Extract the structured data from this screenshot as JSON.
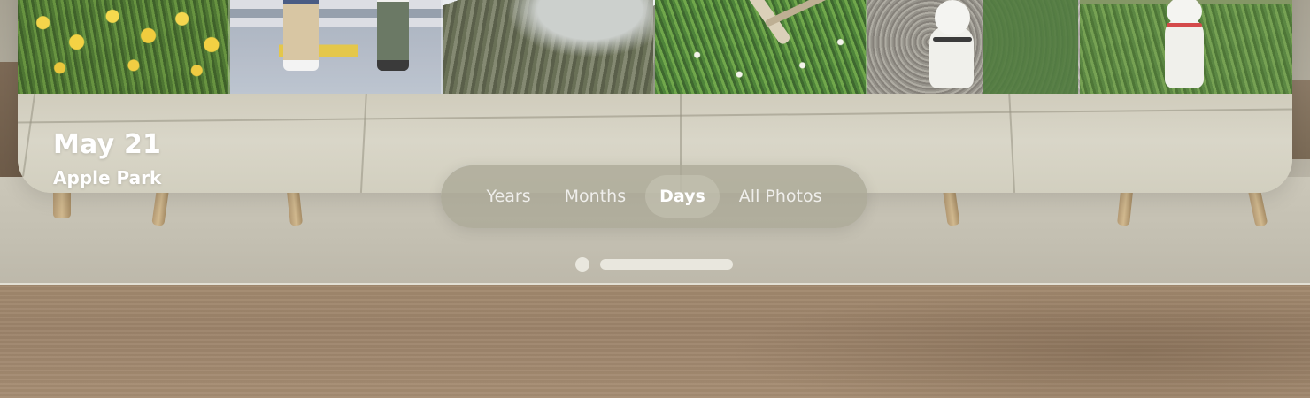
{
  "header": {
    "date": "May 21",
    "location": "Apple Park"
  },
  "photos": [
    {
      "subject": "tulips"
    },
    {
      "subject": "people-on-crosswalk"
    },
    {
      "subject": "coastal-hills"
    },
    {
      "subject": "grass-with-sticks"
    },
    {
      "subject": "dog-on-gravel"
    },
    {
      "subject": "dog-on-lawn"
    }
  ],
  "view_control": {
    "segments": [
      {
        "label": "Years"
      },
      {
        "label": "Months"
      },
      {
        "label": "Days"
      },
      {
        "label": "All Photos"
      }
    ],
    "selected": "Days"
  },
  "colors": {
    "text": "#ffffff",
    "glass": "#aaa896"
  }
}
